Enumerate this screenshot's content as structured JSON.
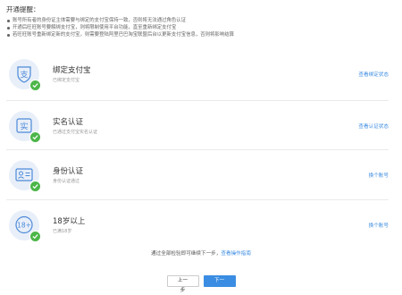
{
  "notice": {
    "title": "开通提醒：",
    "items": [
      "账号所有者的身份证主体需要与绑定的支付宝保持一致，否则将无法通过角色认证",
      "开通后旺旺账号要解绑支付宝，则将限制使用平台功能，直至重新绑定支付宝",
      "若旺旺账号重新绑定新的支付宝，则需要登陆阿里巴巴淘宝联盟后台以更新支付宝信息，否则将影响结算"
    ]
  },
  "rows": [
    {
      "icon": "alipay-icon",
      "title": "绑定支付宝",
      "sub": "已绑定支付宝",
      "action": "查看绑定状态"
    },
    {
      "icon": "real-name-icon",
      "title": "实名认证",
      "sub": "已通过支付宝实名认证",
      "action": "查看认证状态"
    },
    {
      "icon": "id-card-icon",
      "title": "身份认证",
      "sub": "身份认证通过",
      "action": "换个账号"
    },
    {
      "icon": "age-18-icon",
      "title": "18岁以上",
      "sub": "已满18岁",
      "action": "换个账号"
    }
  ],
  "footer": {
    "text": "通过全部检验即可继续下一步，",
    "link": "查看操作指南"
  },
  "buttons": {
    "prev": "上一步",
    "next": "下一步"
  },
  "colors": {
    "accent": "#3b8be0",
    "success": "#4cb649",
    "icon_bg": "#e8eff9"
  }
}
